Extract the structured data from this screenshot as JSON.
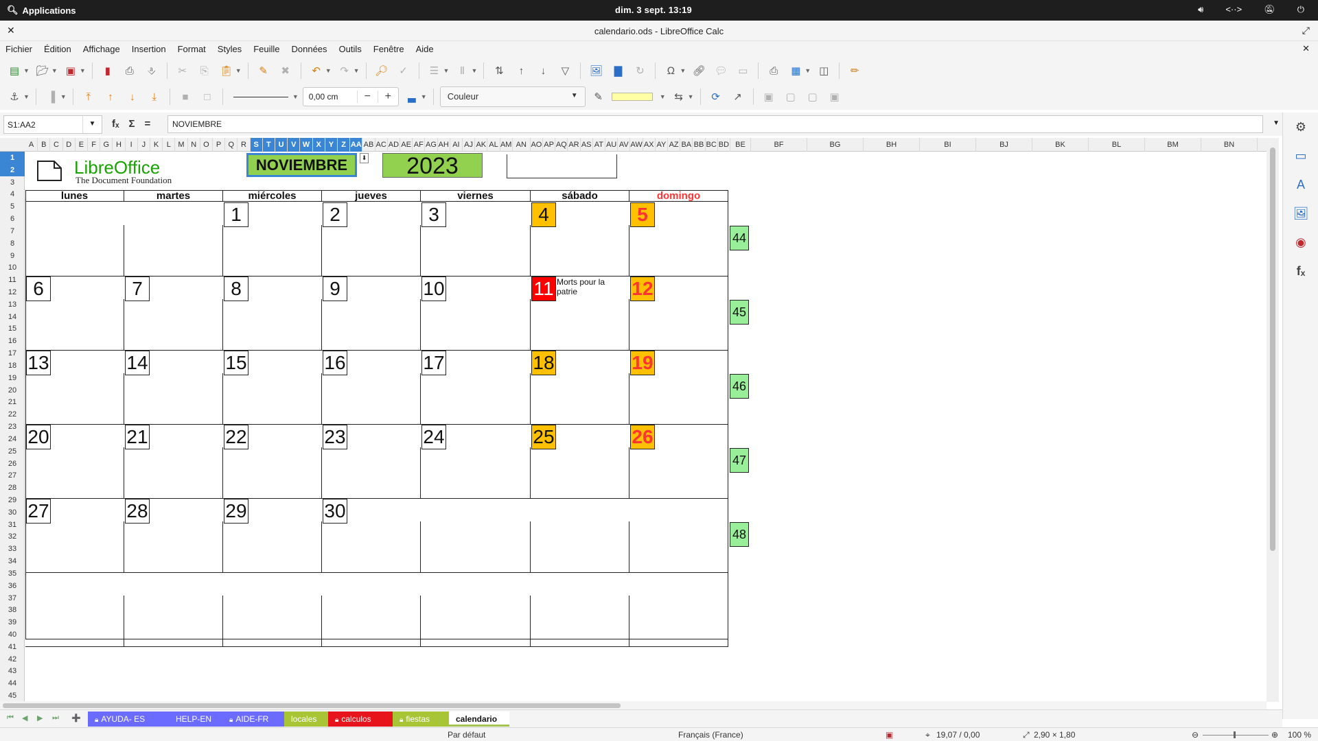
{
  "system": {
    "apps_label": "Applications",
    "clock": "dim. 3 sept.      13:19"
  },
  "window": {
    "title": "calendario.ods - LibreOffice Calc"
  },
  "menu": [
    "Fichier",
    "Édition",
    "Affichage",
    "Insertion",
    "Format",
    "Styles",
    "Feuille",
    "Données",
    "Outils",
    "Fenêtre",
    "Aide"
  ],
  "toolbar2": {
    "line_width": "0,00 cm",
    "area_style": "Couleur"
  },
  "formula": {
    "name_box": "S1:AA2",
    "content": "NOVIEMBRE"
  },
  "columns": [
    "A",
    "B",
    "C",
    "D",
    "E",
    "F",
    "G",
    "H",
    "I",
    "J",
    "K",
    "L",
    "M",
    "N",
    "O",
    "P",
    "Q",
    "R",
    "S",
    "T",
    "U",
    "V",
    "W",
    "X",
    "Y",
    "Z",
    "AA",
    "AB",
    "AC",
    "AD",
    "AE",
    "AF",
    "AG",
    "AH",
    "AI",
    "AJ",
    "AK",
    "AL",
    "AM",
    "AN",
    "AO",
    "AP",
    "AQ",
    "AR",
    "AS",
    "AT",
    "AU",
    "AV",
    "AW",
    "AX",
    "AY",
    "AZ",
    "BA",
    "BB",
    "BC",
    "BD",
    "BE",
    "BF",
    "BG",
    "BH",
    "BI",
    "BJ",
    "BK",
    "BL",
    "BM",
    "BN"
  ],
  "calendar": {
    "logo_name": "LibreOffice",
    "logo_sub": "The Document Foundation",
    "month": "NOVIEMBRE",
    "year": "2023",
    "weekdays": [
      "lunes",
      "martes",
      "miércoles",
      "jueves",
      "viernes",
      "sábado",
      "domingo"
    ],
    "weeks": [
      [
        "",
        "",
        "1",
        "2",
        "3",
        "4",
        "5"
      ],
      [
        "6",
        "7",
        "8",
        "9",
        "10",
        "11",
        "12"
      ],
      [
        "13",
        "14",
        "15",
        "16",
        "17",
        "18",
        "19"
      ],
      [
        "20",
        "21",
        "22",
        "23",
        "24",
        "25",
        "26"
      ],
      [
        "27",
        "28",
        "29",
        "30",
        "",
        "",
        ""
      ],
      [
        "",
        "",
        "",
        "",
        "",
        "",
        ""
      ]
    ],
    "week_numbers": [
      "44",
      "45",
      "46",
      "47",
      "48"
    ],
    "holiday_note": "Morts pour la patrie",
    "colors": {
      "weekend": "#ffc000",
      "holiday": "#ff0000",
      "weeknum": "#99ee99",
      "month_bg": "#92d050",
      "sunday_text": "#ff3333"
    }
  },
  "tabs": [
    {
      "label": "AYUDA- ES",
      "color": "#6b6bff",
      "locked": true
    },
    {
      "label": "HELP-EN",
      "color": "#6b6bff",
      "locked": false
    },
    {
      "label": "AIDE-FR",
      "color": "#6b6bff",
      "locked": true
    },
    {
      "label": "locales",
      "color": "#a8c536",
      "locked": false
    },
    {
      "label": "calculos",
      "color": "#e8141c",
      "locked": true
    },
    {
      "label": "fiestas",
      "color": "#a8c536",
      "locked": true
    },
    {
      "label": "calendario",
      "color": "#ffffff",
      "locked": false
    }
  ],
  "status": {
    "page_style": "Par défaut",
    "language": "Français (France)",
    "position": "19,07 / 0,00",
    "size": "2,90 × 1,80",
    "zoom": "100 %"
  }
}
